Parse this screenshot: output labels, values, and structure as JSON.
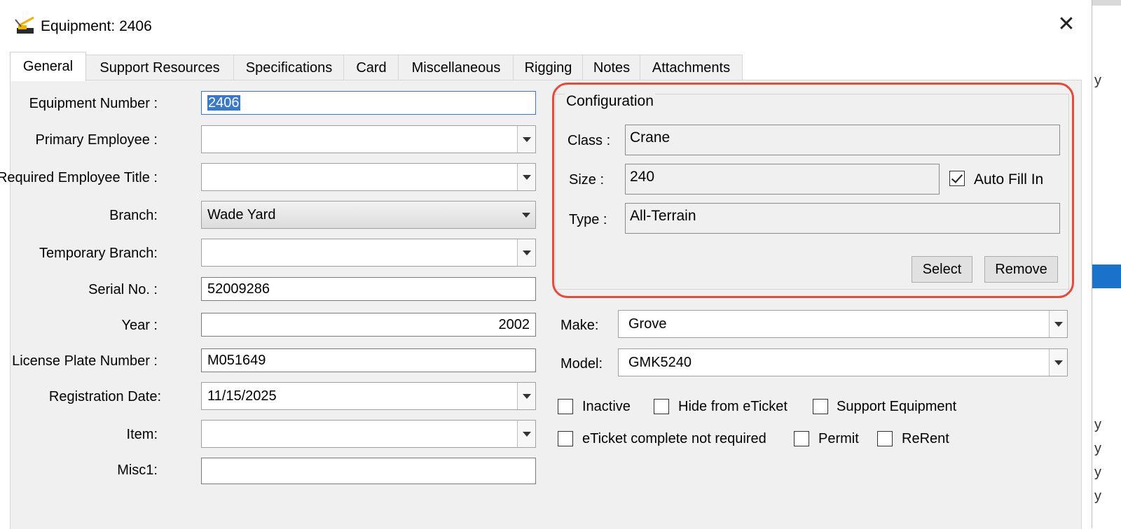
{
  "window": {
    "title": "Equipment: 2406"
  },
  "tabs": [
    "General",
    "Support Resources",
    "Specifications",
    "Card",
    "Miscellaneous",
    "Rigging",
    "Notes",
    "Attachments"
  ],
  "fields": {
    "equipment_number": {
      "label": "Equipment Number :",
      "value": "2406"
    },
    "primary_employee": {
      "label": "Primary Employee :",
      "value": ""
    },
    "required_employee_title": {
      "label": "Required Employee Title :",
      "value": ""
    },
    "branch": {
      "label": "Branch:",
      "value": "Wade Yard"
    },
    "temporary_branch": {
      "label": "Temporary Branch:",
      "value": ""
    },
    "serial_no": {
      "label": "Serial No. :",
      "value": "52009286"
    },
    "year": {
      "label": "Year :",
      "value": "2002"
    },
    "license_plate": {
      "label": "License Plate Number :",
      "value": "M051649"
    },
    "registration_date": {
      "label": "Registration Date:",
      "value": "11/15/2025"
    },
    "item": {
      "label": "Item:",
      "value": ""
    },
    "misc1": {
      "label": "Misc1:",
      "value": ""
    }
  },
  "configuration": {
    "title": "Configuration",
    "class_label": "Class :",
    "class_value": "Crane",
    "size_label": "Size :",
    "size_value": "240",
    "type_label": "Type :",
    "type_value": "All-Terrain",
    "auto_fill_label": "Auto Fill In",
    "auto_fill_checked": true,
    "select_button": "Select",
    "remove_button": "Remove"
  },
  "make": {
    "label": "Make:",
    "value": "Grove"
  },
  "model": {
    "label": "Model:",
    "value": "GMK5240"
  },
  "checkboxes": {
    "inactive": {
      "label": "Inactive",
      "checked": false
    },
    "hide_from_eticket": {
      "label": "Hide from eTicket",
      "checked": false
    },
    "support_equipment": {
      "label": "Support Equipment",
      "checked": false
    },
    "eticket_complete": {
      "label": "eTicket complete not required",
      "checked": false
    },
    "permit": {
      "label": "Permit",
      "checked": false
    },
    "rerent": {
      "label": "ReRent",
      "checked": false
    }
  },
  "background_chars": [
    "y",
    "y",
    "y",
    "y",
    "y"
  ],
  "colors": {
    "highlight": "#e24c3a",
    "selection": "#3a78c8"
  }
}
